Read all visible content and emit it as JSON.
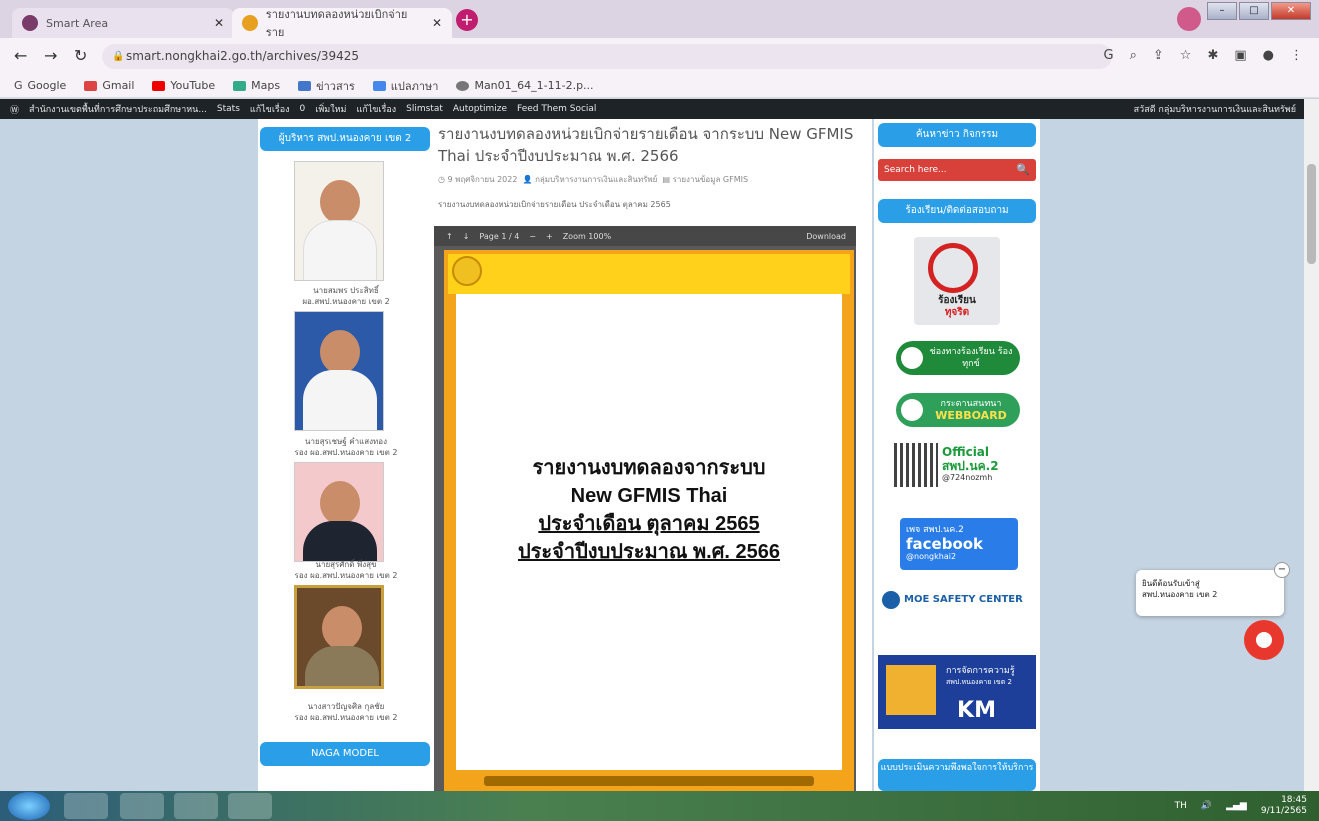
{
  "browser": {
    "tabs": [
      {
        "title": "Smart Area",
        "active": false
      },
      {
        "title": "รายงานบทดลองหน่วยเบิกจ่ายราย",
        "active": true
      }
    ],
    "url": "smart.nongkhai2.go.th/archives/39425",
    "bookmarks": [
      "Google",
      "Gmail",
      "YouTube",
      "Maps",
      "ข่าวสาร",
      "แปลภาษา",
      "Man01_64_1-11-2.p..."
    ],
    "new_tab": "+"
  },
  "wp_admin_bar": {
    "items": [
      "สำนักงานเขตพื้นที่การศึกษาประถมศึกษาหน...",
      "Stats",
      "แก้ไขเรื่อง",
      "0",
      "เพิ่มใหม่",
      "แก้ไขเรื่อง",
      "Slimstat",
      "Autoptimize",
      "Feed Them Social"
    ],
    "greeting": "สวัสดี กลุ่มบริหารงานการเงินและสินทรัพย์"
  },
  "left_sidebar": {
    "header": "ผู้บริหาร สพป.หนองคาย เขต 2",
    "people": [
      {
        "name": "นายสมพร ประสิทธิ์",
        "position": "ผอ.สพป.หนองคาย เขต 2"
      },
      {
        "name": "นายสุรเชษฐ์ คำแสงทอง",
        "position": "รอง ผอ.สพป.หนองคาย เขต 2"
      },
      {
        "name": "นายสุรศักดิ์ พึ่งสุข",
        "position": "รอง ผอ.สพป.หนองคาย เขต 2"
      },
      {
        "name": "นางสาวปัญจศิล กุลชัย",
        "position": "รอง ผอ.สพป.หนองคาย เขต 2"
      }
    ],
    "footer_button": "NAGA MODEL"
  },
  "post": {
    "title": "รายงานงบทดลองหน่วยเบิกจ่ายรายเดือน จากระบบ New GFMIS Thai ประจำปีงบประมาณ พ.ศ. 2566",
    "date": "9 พฤศจิกายน 2022",
    "author": "กลุ่มบริหารงานการเงินและสินทรัพย์",
    "category": "รายงานข้อมูล GFMIS",
    "excerpt": "รายงานงบทดลองหน่วยเบิกจ่ายรายเดือน ประจำเดือน ตุลาคม 2565"
  },
  "pdf_viewer": {
    "page_label": "Page 1 / 4",
    "zoom": "Zoom 100%",
    "download": "Download",
    "doc_lines": [
      "รายงานงบทดลองจากระบบ",
      "New GFMIS Thai",
      "ประจำเดือน ตุลาคม 2565",
      "ประจำปีงบประมาณ พ.ศ. 2566"
    ]
  },
  "right_sidebar": {
    "news_button": "ค้นหาข่าว กิจกรรม",
    "search_placeholder": "Search here...",
    "complaint_button": "ร้องเรียน/ติดต่อสอบถาม",
    "anticorrupt_line1": "ร้องเรียน",
    "anticorrupt_line2": "ทุจริต",
    "green_button": "ช่องทางร้องเรียน ร้องทุกข์",
    "webboard_small": "กระดานสนทนา",
    "webboard": "WEBBOARD",
    "line_official": "Official",
    "line_name": "สพป.นค.2",
    "line_id": "@724nozmh",
    "fb_small": "เพจ สพป.นค.2",
    "fb_big": "facebook",
    "fb_handle": "@nongkhai2",
    "moe": "MOE SAFETY CENTER",
    "km_title": "การจัดการความรู้",
    "km_sub": "สพป.หนองคาย เขต 2",
    "km": "KM",
    "bottom_button": "แบบประเมินความพึงพอใจการให้บริการ"
  },
  "chat": {
    "greeting_line1": "ยินดีต้อนรับเข้าสู่",
    "greeting_line2": "สพป.หนองคาย เขต 2",
    "close": "−"
  },
  "taskbar": {
    "lang": "TH",
    "time": "18:45",
    "date": "9/11/2565"
  }
}
